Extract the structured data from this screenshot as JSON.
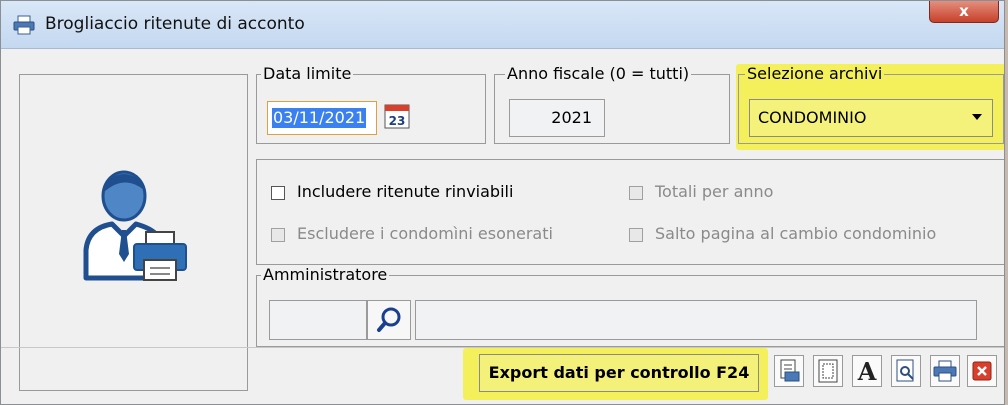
{
  "window": {
    "title": "Brogliaccio ritenute di acconto",
    "close_label": "x",
    "close_color": "#c7402a"
  },
  "data_limite": {
    "legend": "Data limite",
    "value": "03/11/2021",
    "calendar_day": "23"
  },
  "anno_fiscale": {
    "legend": "Anno fiscale (0 = tutti)",
    "value": "2021"
  },
  "selezione_archivi": {
    "legend": "Selezione archivi",
    "value": "CONDOMINIO",
    "highlight_color": "#f3f05c"
  },
  "options": {
    "includere": {
      "label": "Includere ritenute rinviabili",
      "checked": false,
      "enabled": true
    },
    "escludere": {
      "label": "Escludere i condomìni esonerati",
      "checked": false,
      "enabled": false
    },
    "totali": {
      "label": "Totali per anno",
      "checked": false,
      "enabled": false
    },
    "salto": {
      "label": "Salto pagina al cambio condominio",
      "checked": false,
      "enabled": false
    }
  },
  "amministratore": {
    "legend": "Amministratore",
    "code": "",
    "name": ""
  },
  "toolbar": {
    "export_label": "Export dati per controllo F24",
    "font_label": "A",
    "buttons": [
      "print-layout-icon",
      "page-setup-icon",
      "font-icon",
      "print-preview-icon",
      "printer-icon",
      "close-icon"
    ]
  }
}
